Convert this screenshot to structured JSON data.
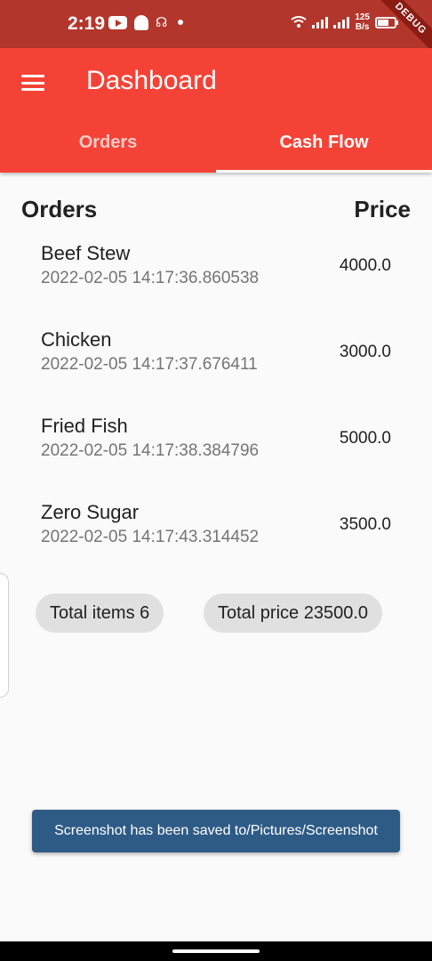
{
  "status_bar": {
    "time": "2:19",
    "speed_value": "125",
    "speed_unit": "B/s",
    "debug_label": "DEBUG",
    "battery_level": 0.68
  },
  "app_bar": {
    "title": "Dashboard",
    "tabs": [
      {
        "label": "Orders",
        "active": false
      },
      {
        "label": "Cash Flow",
        "active": true
      }
    ]
  },
  "list": {
    "header_orders": "Orders",
    "header_price": "Price",
    "items": [
      {
        "name": "Beef Stew",
        "date": "2022-02-05 14:17:36.860538",
        "price": "4000.0"
      },
      {
        "name": "Chicken",
        "date": "2022-02-05 14:17:37.676411",
        "price": "3000.0"
      },
      {
        "name": "Fried Fish",
        "date": "2022-02-05 14:17:38.384796",
        "price": "5000.0"
      },
      {
        "name": "Zero Sugar",
        "date": "2022-02-05 14:17:43.314452",
        "price": "3500.0"
      }
    ]
  },
  "summary": {
    "total_items": "Total items 6",
    "total_price": "Total price 23500.0"
  },
  "snackbar": {
    "message": "Screenshot has been saved to/Pictures/Screenshot"
  },
  "colors": {
    "primary": "#f44336",
    "status_bar": "#b3362c",
    "snackbar": "#2e5b86"
  }
}
